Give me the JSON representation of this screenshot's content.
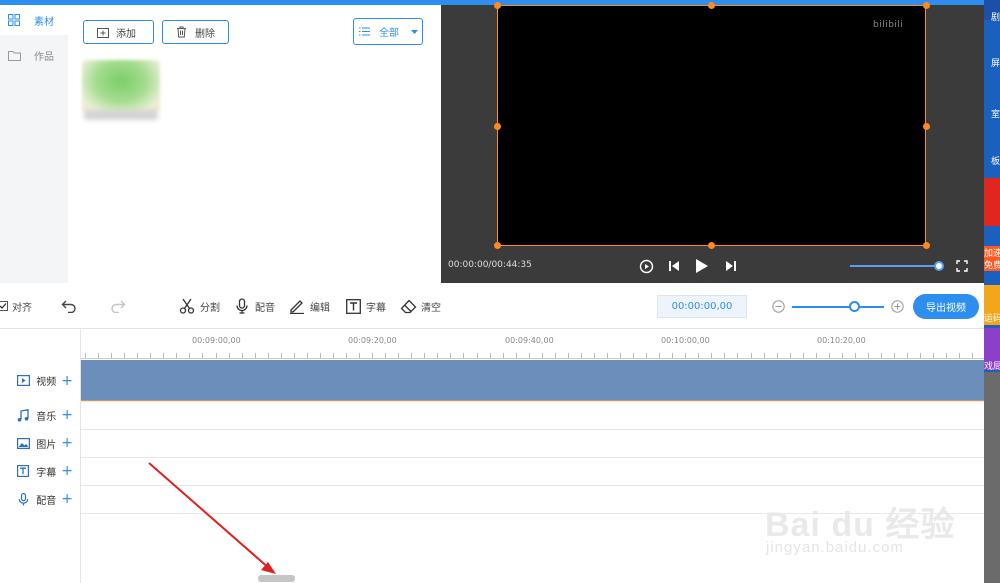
{
  "sidebar": {
    "items": [
      {
        "label": "素材",
        "icon": "grid-icon",
        "active": true
      },
      {
        "label": "作品",
        "icon": "folder-icon",
        "active": false
      }
    ]
  },
  "material": {
    "add_label": "添加",
    "delete_label": "删除",
    "filter_label": "全部"
  },
  "preview": {
    "watermark": "bilibili",
    "time": "00:00:00/00:44:35",
    "volume_level": 0.95
  },
  "right_strip": {
    "items": [
      "剧",
      "屏",
      "室",
      "板",
      "加速",
      "免费",
      "运码",
      "戏局"
    ]
  },
  "toolbar": {
    "align_label": "对齐",
    "align_checked": true,
    "split_label": "分割",
    "dub_label": "配音",
    "edit_label": "编辑",
    "subtitle_label": "字幕",
    "clear_label": "清空",
    "timecode": "00:00:00,00",
    "export_label": "导出视频",
    "zoom_level": 0.63
  },
  "timeline": {
    "ruler_labels": [
      "00:09:00,00",
      "00:09:20,00",
      "00:09:40,00",
      "00:10:00,00",
      "00:10:20,00"
    ],
    "tracks": [
      {
        "label": "视频",
        "icon": "video-track-icon"
      },
      {
        "label": "音乐",
        "icon": "music-note-icon"
      },
      {
        "label": "图片",
        "icon": "image-icon"
      },
      {
        "label": "字幕",
        "icon": "text-t-icon"
      },
      {
        "label": "配音",
        "icon": "microphone-icon"
      }
    ]
  },
  "watermark": {
    "brand": "Bai du 经验",
    "url": "jingyan.baidu.com"
  },
  "colors": {
    "accent": "#2e8ef0",
    "handle": "#ff8a1f",
    "video_clip": "#6b8fba",
    "annotation_arrow": "#e02020"
  }
}
